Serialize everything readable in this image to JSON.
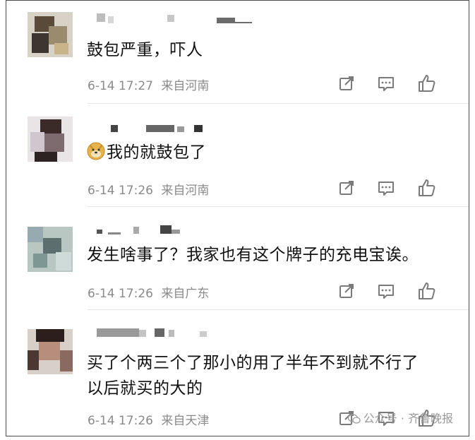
{
  "comments": [
    {
      "username": "",
      "text_lines": [
        "鼓包严重，吓人"
      ],
      "date": "6-14 17:27",
      "location": "来自河南",
      "emoji": null
    },
    {
      "username": "",
      "text_lines": [
        "我的就鼓包了"
      ],
      "date": "6-14 17:26",
      "location": "来自河南",
      "emoji": "doge-emoji"
    },
    {
      "username": "",
      "text_lines": [
        "发生啥事了？我家也有这个牌子的充电宝诶。"
      ],
      "date": "6-14 17:26",
      "location": "来自广东",
      "emoji": null
    },
    {
      "username": "",
      "text_lines": [
        "买了个两三个了那小的用了半年不到就不行了",
        "以后就买的大的"
      ],
      "date": "6-14 17:26",
      "location": "来自天津",
      "emoji": null
    }
  ],
  "icons": [
    "share-icon",
    "comment-icon",
    "like-icon"
  ],
  "watermark": "公众号 · 齐鲁晚报",
  "colors": {
    "text": "#111111",
    "meta": "#8a8a8a",
    "icon": "#7a7a7a",
    "divider": "#e6e6e6"
  }
}
